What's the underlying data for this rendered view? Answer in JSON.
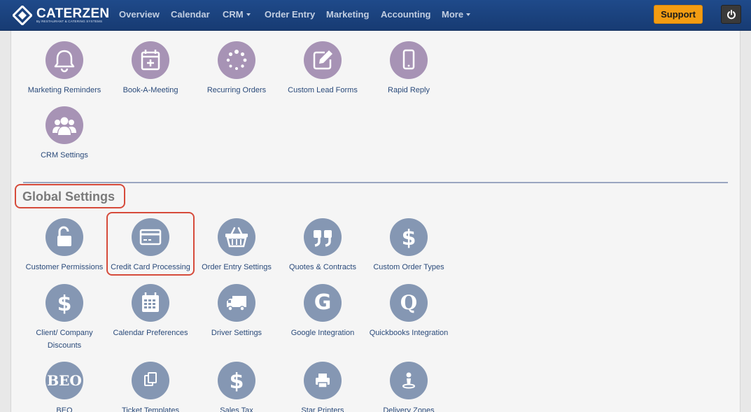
{
  "header": {
    "logo_text": "CATERZEN",
    "logo_sub": "By RESTAURANT & CATERING SYSTEMS",
    "nav": [
      {
        "label": "Overview"
      },
      {
        "label": "Calendar"
      },
      {
        "label": "CRM"
      },
      {
        "label": "Order Entry"
      },
      {
        "label": "Marketing"
      },
      {
        "label": "Accounting"
      },
      {
        "label": "More"
      }
    ],
    "support_label": "Support"
  },
  "crm": {
    "tiles": [
      {
        "label": "Marketing Reminders",
        "icon": "bell-icon"
      },
      {
        "label": "Book-A-Meeting",
        "icon": "calendar-plus-icon"
      },
      {
        "label": "Recurring Orders",
        "icon": "spinner-icon"
      },
      {
        "label": "Custom Lead Forms",
        "icon": "edit-icon"
      },
      {
        "label": "Rapid Reply",
        "icon": "mobile-icon"
      },
      {
        "label": "CRM Settings",
        "icon": "users-icon"
      }
    ]
  },
  "global": {
    "title": "Global Settings",
    "tiles": [
      {
        "label": "Customer Permissions",
        "icon": "unlock-icon"
      },
      {
        "label": "Credit Card Processing",
        "icon": "credit-card-icon"
      },
      {
        "label": "Order Entry Settings",
        "icon": "basket-icon"
      },
      {
        "label": "Quotes & Contracts",
        "icon": "quote-icon"
      },
      {
        "label": "Custom Order Types",
        "icon": "dollar-icon"
      },
      {
        "label": "Client/ Company Discounts",
        "icon": "dollar-icon"
      },
      {
        "label": "Calendar Preferences",
        "icon": "calendar-icon"
      },
      {
        "label": "Driver Settings",
        "icon": "truck-icon"
      },
      {
        "label": "Google Integration",
        "icon": "google-icon",
        "glyph": "G"
      },
      {
        "label": "Quickbooks Integration",
        "icon": "quickbooks-icon",
        "glyph": "Q"
      },
      {
        "label": "BEO",
        "icon": "beo-icon",
        "glyph": "BEO"
      },
      {
        "label": "Ticket Templates",
        "icon": "copy-icon"
      },
      {
        "label": "Sales Tax",
        "icon": "dollar-icon"
      },
      {
        "label": "Star Printers",
        "icon": "printer-icon"
      },
      {
        "label": "Delivery Zones",
        "icon": "map-pin-icon"
      }
    ]
  },
  "colors": {
    "nav_bg": "#1f4a8a",
    "support": "#f39c12",
    "crm_circle": "#a793b5",
    "global_circle": "#8597b3",
    "highlight": "#d64b3b"
  }
}
